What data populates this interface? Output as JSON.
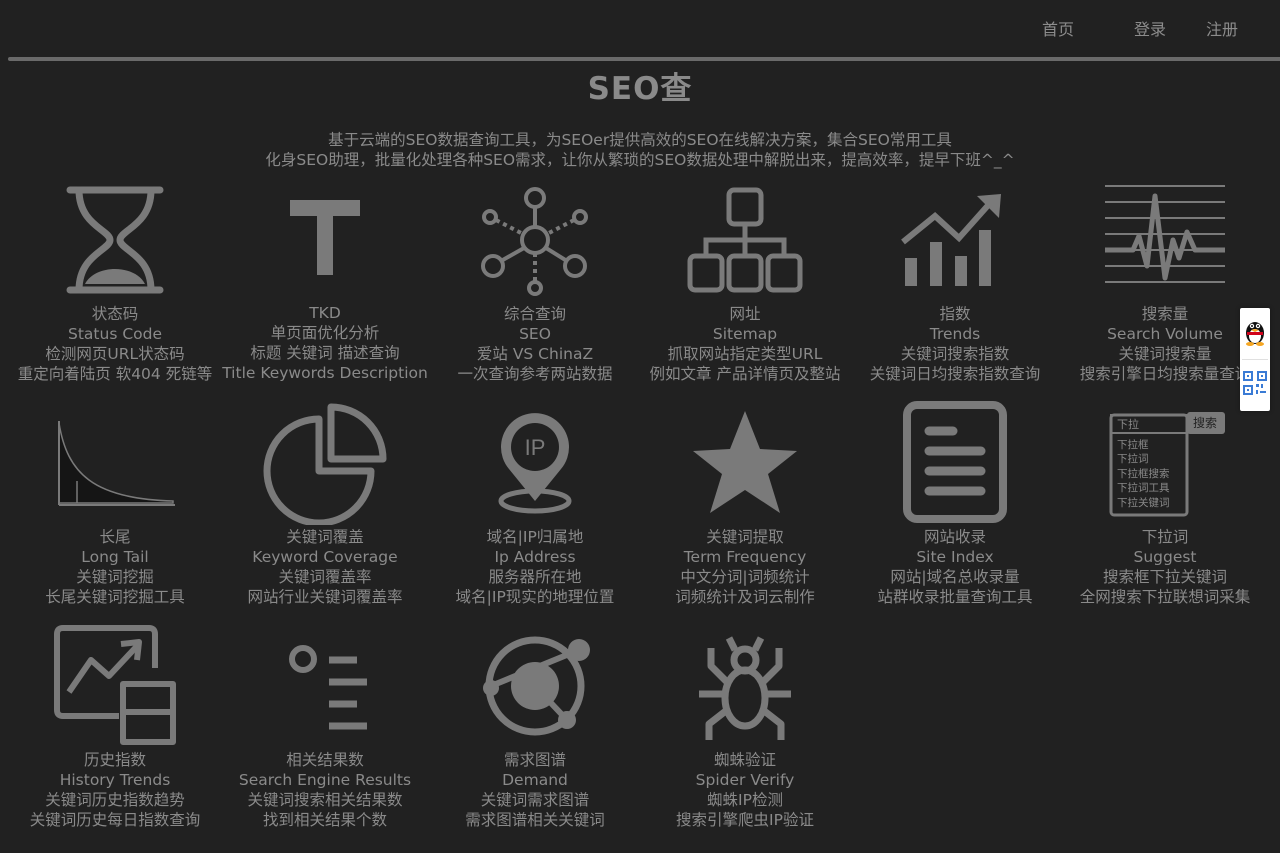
{
  "nav": {
    "home": "首页",
    "login": "登录",
    "register": "注册"
  },
  "page": {
    "title": "SEO查",
    "desc1": "基于云端的SEO数据查询工具，为SEOer提供高效的SEO在线解决方案，集合SEO常用工具",
    "desc2": "化身SEO助理，批量化处理各种SEO需求，让你从繁琐的SEO数据处理中解脱出来，提高效率，提早下班^_^"
  },
  "tools": [
    {
      "icon": "hourglass-icon",
      "lines": [
        "状态码",
        "Status Code",
        "检测网页URL状态码",
        "重定向着陆页 软404 死链等"
      ]
    },
    {
      "icon": "text-t-icon",
      "lines": [
        "TKD",
        "单页面优化分析",
        "标题 关键词 描述查询",
        "Title Keywords Description"
      ]
    },
    {
      "icon": "network-hub-icon",
      "lines": [
        "综合查询",
        "SEO",
        "爱站 VS ChinaZ",
        "一次查询参考两站数据"
      ]
    },
    {
      "icon": "sitemap-icon",
      "lines": [
        "网址",
        "Sitemap",
        "抓取网站指定类型URL",
        "例如文章 产品详情页及整站"
      ]
    },
    {
      "icon": "bar-trend-icon",
      "lines": [
        "指数",
        "Trends",
        "关键词搜索指数",
        "关键词日均搜索指数查询"
      ]
    },
    {
      "icon": "pulse-wave-icon",
      "lines": [
        "搜索量",
        "Search Volume",
        "关键词搜索量",
        "搜索引擎日均搜索量查询"
      ]
    },
    {
      "icon": "long-tail-curve-icon",
      "lines": [
        "长尾",
        "Long Tail",
        "关键词挖掘",
        "长尾关键词挖掘工具"
      ]
    },
    {
      "icon": "pie-chart-icon",
      "lines": [
        "关键词覆盖",
        "Keyword Coverage",
        "关键词覆盖率",
        "网站行业关键词覆盖率"
      ]
    },
    {
      "icon": "ip-pin-icon",
      "lines": [
        "域名|IP归属地",
        "Ip Address",
        "服务器所在地",
        "域名|IP现实的地理位置"
      ]
    },
    {
      "icon": "star-icon",
      "lines": [
        "关键词提取",
        "Term Frequency",
        "中文分词|词频统计",
        "词频统计及词云制作"
      ]
    },
    {
      "icon": "document-list-icon",
      "lines": [
        "网站收录",
        "Site Index",
        "网站|域名总收录量",
        "站群收录批量查询工具"
      ]
    },
    {
      "icon": "dropdown-suggest-icon",
      "lines": [
        "下拉词",
        "Suggest",
        "搜索框下拉关键词",
        "全网搜索下拉联想词采集"
      ]
    },
    {
      "icon": "history-chart-icon",
      "lines": [
        "历史指数",
        "History Trends",
        "关键词历史指数趋势",
        "关键词历史每日指数查询"
      ]
    },
    {
      "icon": "result-list-icon",
      "lines": [
        "相关结果数",
        "Search Engine Results",
        "关键词搜索相关结果数",
        "找到相关结果个数"
      ]
    },
    {
      "icon": "orbit-graph-icon",
      "lines": [
        "需求图谱",
        "Demand",
        "关键词需求图谱",
        "需求图谱相关关键词"
      ]
    },
    {
      "icon": "spider-icon",
      "lines": [
        "蜘蛛验证",
        "Spider Verify",
        "蜘蛛IP检测",
        "搜索引擎爬虫IP验证"
      ]
    }
  ],
  "suggest_icon_text": {
    "input": "下拉",
    "button": "搜索",
    "items": [
      "下拉框",
      "下拉词",
      "下拉框搜索",
      "下拉词工具",
      "下拉关键词"
    ]
  },
  "ip_icon_text": "IP",
  "side": {
    "qq_icon": "qq-penguin-icon",
    "qr_icon": "qr-code-icon"
  },
  "colors": {
    "background": "#212121",
    "text": "#8a8a8a",
    "icon": "#7a7a7a"
  }
}
